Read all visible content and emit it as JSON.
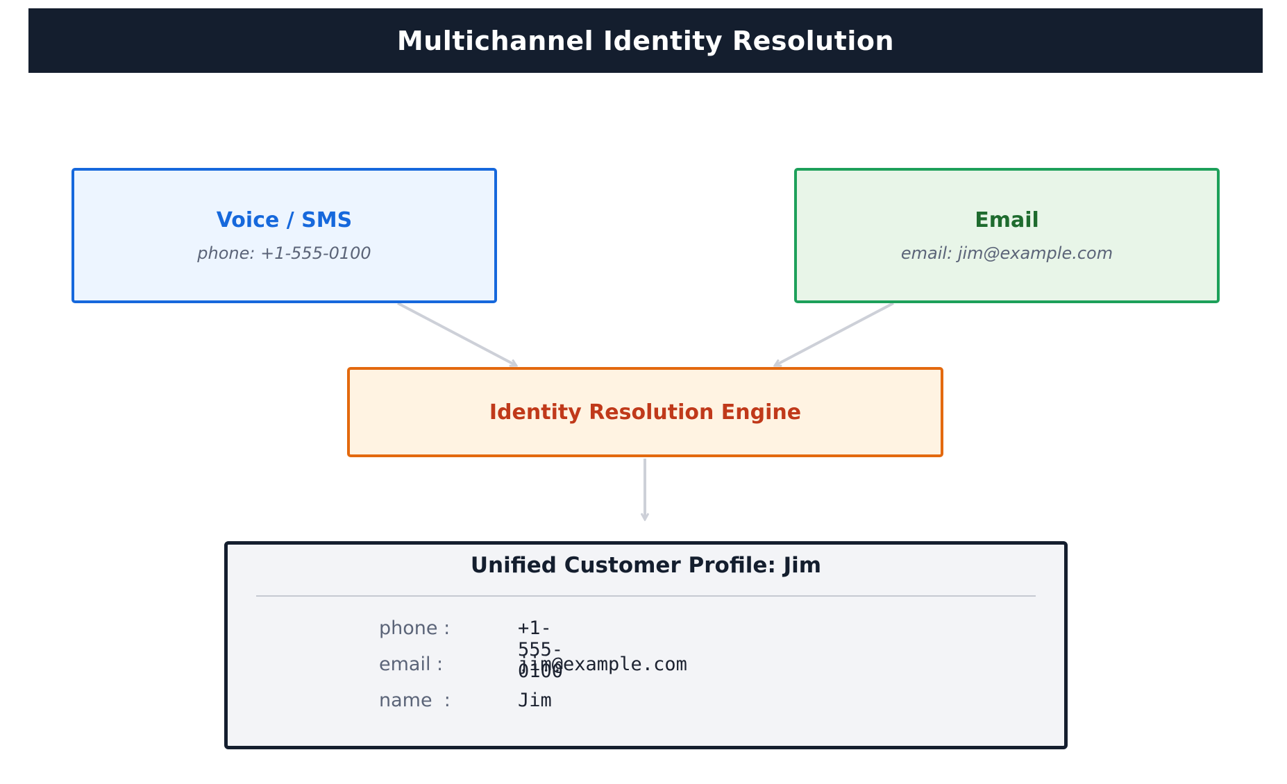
{
  "header": {
    "title": "Multichannel Identity Resolution"
  },
  "nodes": {
    "voice": {
      "title": "Voice / SMS",
      "subtitle": "phone: +1-555-0100"
    },
    "email": {
      "title": "Email",
      "subtitle": "email: jim@example.com"
    },
    "engine": {
      "title": "Identity Resolution Engine"
    }
  },
  "profile": {
    "title": "Unified Customer Profile: Jim",
    "fields": [
      {
        "key": "phone :",
        "value": "+1-555-0100"
      },
      {
        "key": "email :",
        "value": "jim@example.com"
      },
      {
        "key": "name  :",
        "value": "Jim"
      }
    ]
  },
  "edges": [
    {
      "from": "voice",
      "to": "engine"
    },
    {
      "from": "email",
      "to": "engine"
    },
    {
      "from": "engine",
      "to": "profile"
    }
  ],
  "colors": {
    "header_bg": "#141e2e",
    "voice": "#1668dc",
    "email": "#1da05a",
    "engine": "#e3690e",
    "profile_border": "#141e2e",
    "arrow": "#cdd0d8"
  }
}
